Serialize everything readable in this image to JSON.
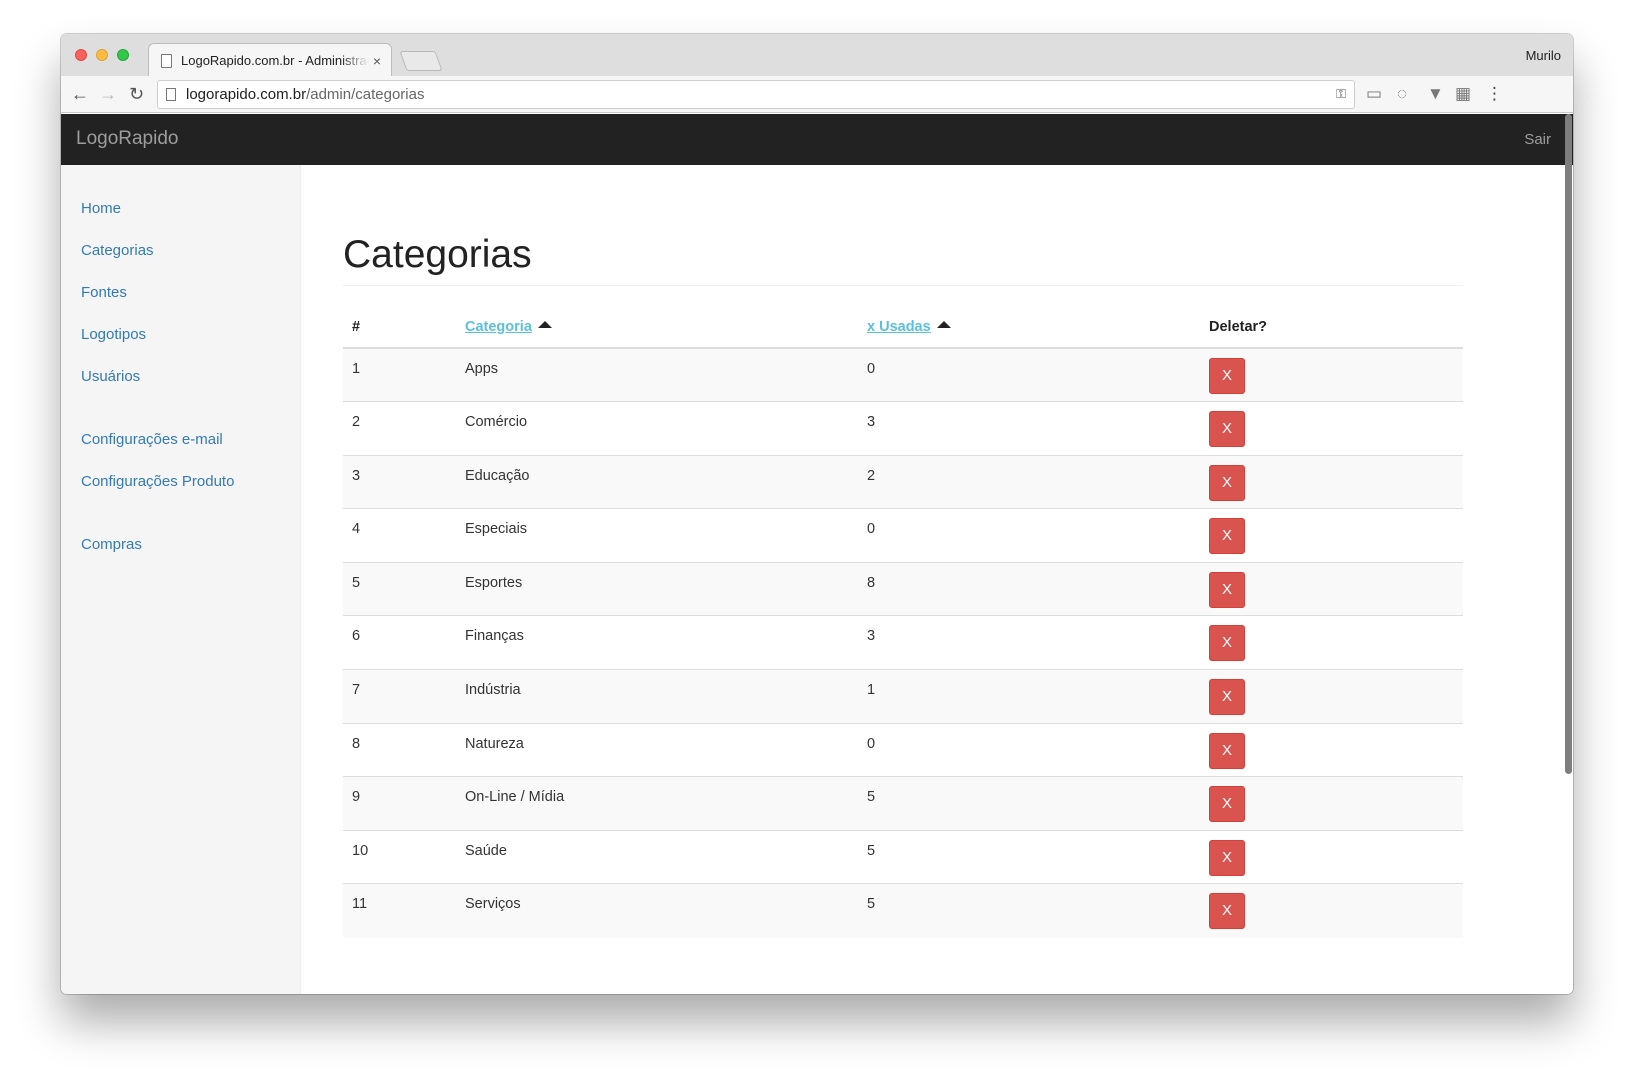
{
  "browser": {
    "tab_title": "LogoRapido.com.br - Administração",
    "tab_close": "×",
    "profile_name": "Murilo",
    "url_host": "logorapido.com.br",
    "url_path": "/admin/categorias",
    "nav_back": "←",
    "nav_forward": "→",
    "nav_reload": "↻",
    "ext_icons": [
      "cast-icon",
      "extension-circle-icon",
      "vivaldi-icon",
      "qr-icon",
      "menu-dots-icon"
    ]
  },
  "navbar": {
    "brand": "LogoRapido",
    "logout": "Sair",
    "bg_color": "#222222"
  },
  "sidebar": {
    "groups": [
      [
        "Home",
        "Categorias",
        "Fontes",
        "Logotipos",
        "Usuários"
      ],
      [
        "Configurações e-mail",
        "Configurações Produto"
      ],
      [
        "Compras"
      ]
    ]
  },
  "main": {
    "title": "Categorias",
    "table": {
      "headers": [
        "#",
        "Categoria",
        "x Usadas",
        "Deletar?"
      ],
      "delete_label": "X",
      "rows": [
        [
          "1",
          "Apps",
          "0"
        ],
        [
          "2",
          "Comércio",
          "3"
        ],
        [
          "3",
          "Educação",
          "2"
        ],
        [
          "4",
          "Especiais",
          "0"
        ],
        [
          "5",
          "Esportes",
          "8"
        ],
        [
          "6",
          "Finanças",
          "3"
        ],
        [
          "7",
          "Indústria",
          "1"
        ],
        [
          "8",
          "Natureza",
          "0"
        ],
        [
          "9",
          "On-Line / Mídia",
          "5"
        ],
        [
          "10",
          "Saúde",
          "5"
        ],
        [
          "11",
          "Serviços",
          "5"
        ]
      ]
    },
    "danger_color": "#d9534f",
    "link_color": "#337ab7",
    "sort_link_color": "#5bc0de"
  }
}
